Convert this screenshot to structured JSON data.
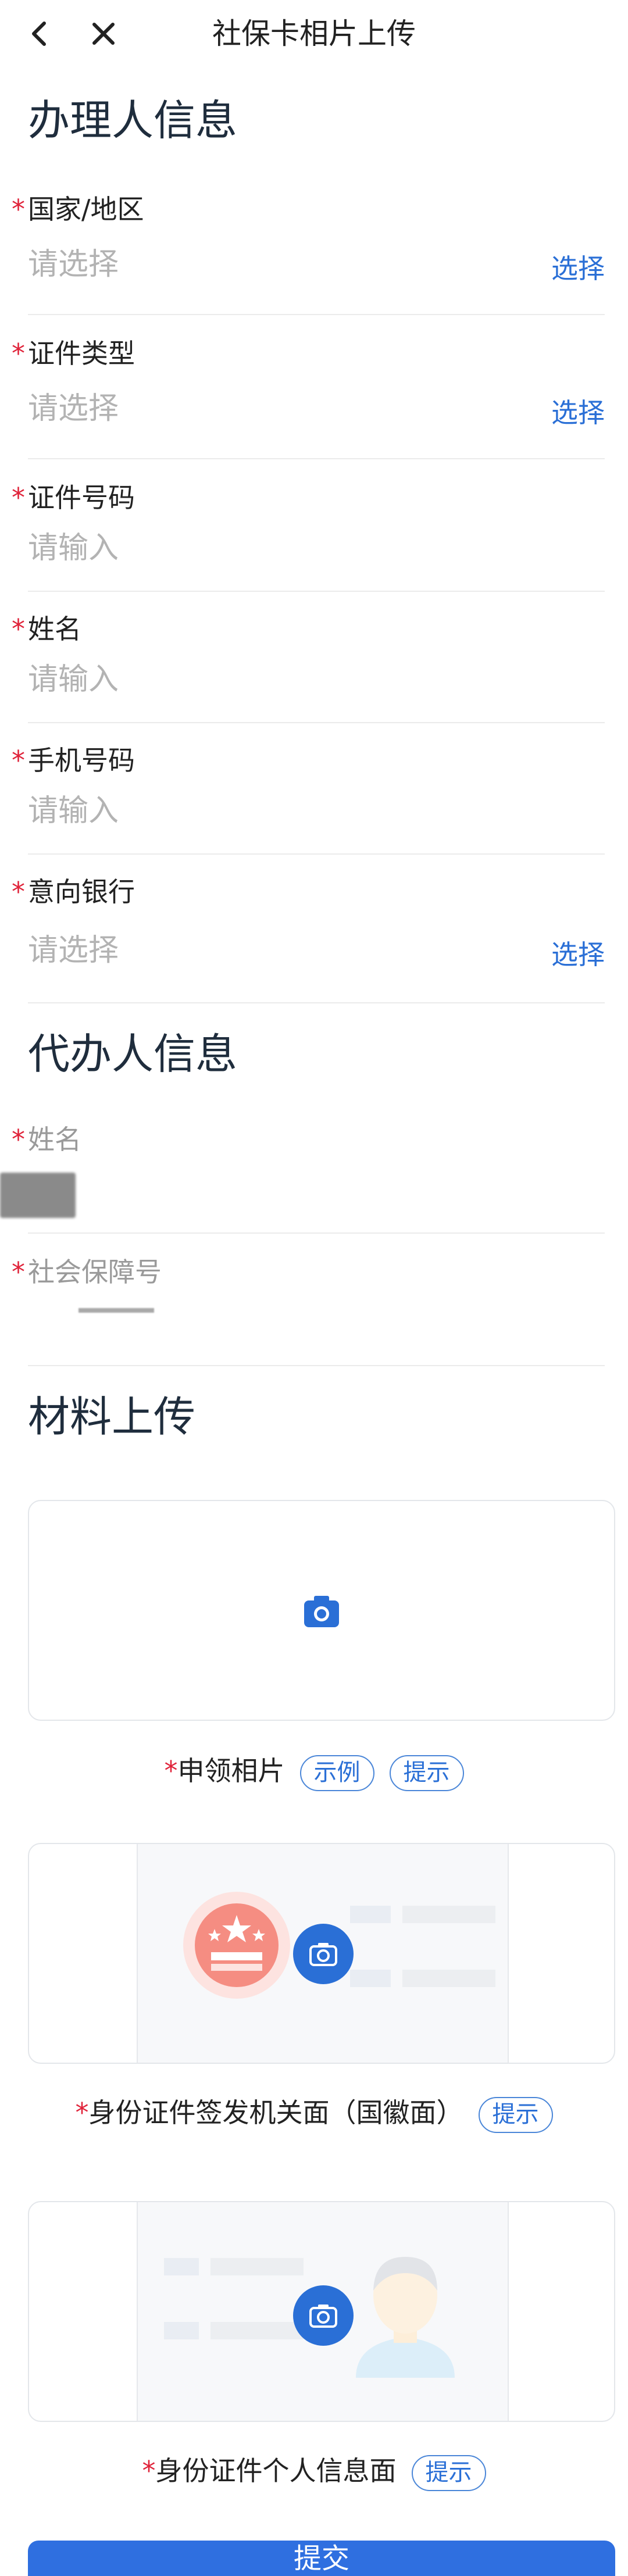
{
  "header": {
    "title": "社保卡相片上传",
    "back_icon": "chevron-left-icon",
    "close_icon": "close-icon"
  },
  "handler_section": {
    "title": "办理人信息",
    "fields": [
      {
        "label": "国家/地区",
        "required": "*",
        "value": "请选择",
        "action": "选择"
      },
      {
        "label": "证件类型",
        "required": "*",
        "value": "请选择",
        "action": "选择"
      },
      {
        "label": "证件号码",
        "required": "*",
        "placeholder": "请输入"
      },
      {
        "label": "姓名",
        "required": "*",
        "placeholder": "请输入"
      },
      {
        "label": "手机号码",
        "required": "*",
        "placeholder": "请输入"
      },
      {
        "label": "意向银行",
        "required": "*",
        "value": "请选择",
        "action": "选择"
      }
    ]
  },
  "agent_section": {
    "title": "代办人信息",
    "fields": [
      {
        "label": "姓名",
        "required": "*"
      },
      {
        "label": "社会保障号",
        "required": "*"
      }
    ]
  },
  "upload_section": {
    "title": "材料上传",
    "items": [
      {
        "required": "*",
        "caption": "申领相片",
        "tags": [
          "示例",
          "提示"
        ]
      },
      {
        "required": "*",
        "caption": "身份证件签发机关面（国徽面）",
        "tags": [
          "提示"
        ]
      },
      {
        "required": "*",
        "caption": "身份证件个人信息面",
        "tags": [
          "提示"
        ]
      }
    ]
  },
  "submit": {
    "label": "提交"
  },
  "colors": {
    "accent": "#2a6fd6",
    "required": "#e0233a",
    "placeholder": "#b3b3b3"
  }
}
